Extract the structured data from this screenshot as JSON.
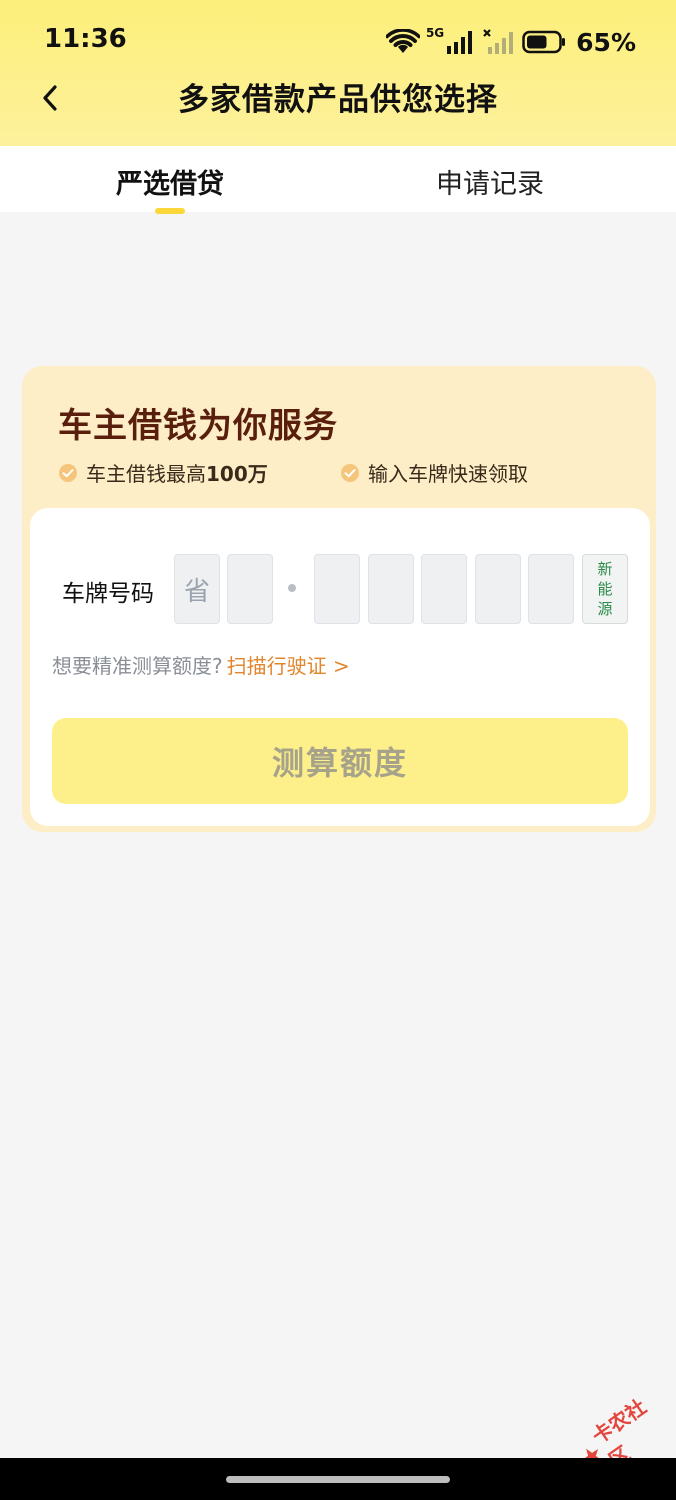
{
  "status_bar": {
    "time": "11:36",
    "network_label": "5G",
    "battery_percent": "65%",
    "battery_level": 0.65
  },
  "nav": {
    "title": "多家借款产品供您选择"
  },
  "tabs": [
    {
      "label": "严选借贷",
      "active": true
    },
    {
      "label": "申请记录",
      "active": false
    }
  ],
  "card": {
    "title": "车主借钱为你服务",
    "features": [
      {
        "text": "车主借钱最高",
        "bold": "100万"
      },
      {
        "text": "输入车牌快速领取",
        "bold": ""
      }
    ],
    "plate": {
      "label": "车牌号码",
      "province_placeholder": "省",
      "new_energy_label": [
        "新",
        "能",
        "源"
      ]
    },
    "hint": "想要精准测算额度?",
    "hint_link": "扫描行驶证 >",
    "button_label": "测算额度"
  },
  "watermark": {
    "text": "卡农社区"
  },
  "colors": {
    "header_yellow": "#fdef7a",
    "tab_indicator": "#fcd73a",
    "card_bg": "#fdeec8",
    "card_title": "#5a1e0c",
    "link_orange": "#e2862e",
    "new_energy_green": "#2c8a4b",
    "button_bg": "#fdf08a"
  }
}
